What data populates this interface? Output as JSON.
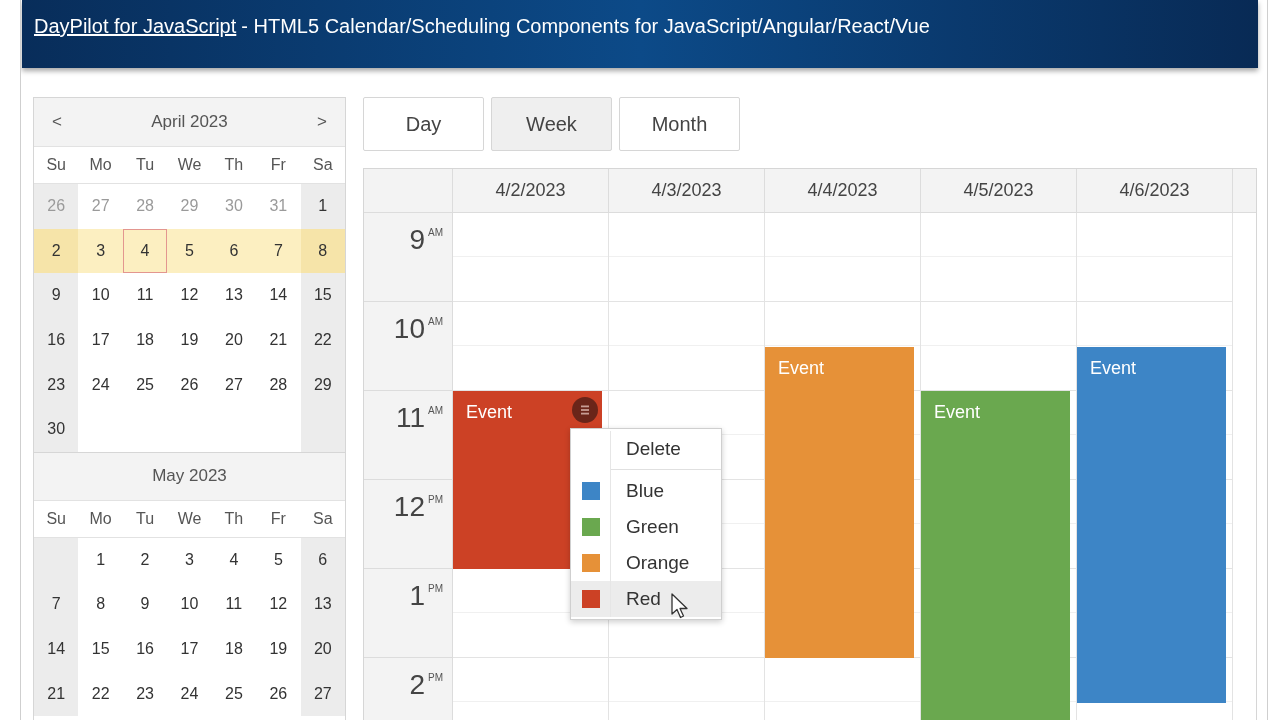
{
  "banner": {
    "link": "DayPilot for JavaScript",
    "tagline": "- HTML5 Calendar/Scheduling Components for JavaScript/Angular/React/Vue"
  },
  "navigator": {
    "months": [
      {
        "prev": "<",
        "title": "April 2023",
        "next": ">",
        "weekdays": [
          "Su",
          "Mo",
          "Tu",
          "We",
          "Th",
          "Fr",
          "Sa"
        ],
        "weeks": [
          {
            "selected": false,
            "days": [
              {
                "text": "26",
                "other_month": true,
                "today": false
              },
              {
                "text": "27",
                "other_month": true,
                "today": false
              },
              {
                "text": "28",
                "other_month": true,
                "today": false
              },
              {
                "text": "29",
                "other_month": true,
                "today": false
              },
              {
                "text": "30",
                "other_month": true,
                "today": false
              },
              {
                "text": "31",
                "other_month": true,
                "today": false
              },
              {
                "text": "1",
                "other_month": false,
                "today": false
              }
            ]
          },
          {
            "selected": true,
            "days": [
              {
                "text": "2",
                "other_month": false,
                "today": false
              },
              {
                "text": "3",
                "other_month": false,
                "today": false
              },
              {
                "text": "4",
                "other_month": false,
                "today": true
              },
              {
                "text": "5",
                "other_month": false,
                "today": false
              },
              {
                "text": "6",
                "other_month": false,
                "today": false
              },
              {
                "text": "7",
                "other_month": false,
                "today": false
              },
              {
                "text": "8",
                "other_month": false,
                "today": false
              }
            ]
          },
          {
            "selected": false,
            "days": [
              {
                "text": "9",
                "other_month": false,
                "today": false
              },
              {
                "text": "10",
                "other_month": false,
                "today": false
              },
              {
                "text": "11",
                "other_month": false,
                "today": false
              },
              {
                "text": "12",
                "other_month": false,
                "today": false
              },
              {
                "text": "13",
                "other_month": false,
                "today": false
              },
              {
                "text": "14",
                "other_month": false,
                "today": false
              },
              {
                "text": "15",
                "other_month": false,
                "today": false
              }
            ]
          },
          {
            "selected": false,
            "days": [
              {
                "text": "16",
                "other_month": false,
                "today": false
              },
              {
                "text": "17",
                "other_month": false,
                "today": false
              },
              {
                "text": "18",
                "other_month": false,
                "today": false
              },
              {
                "text": "19",
                "other_month": false,
                "today": false
              },
              {
                "text": "20",
                "other_month": false,
                "today": false
              },
              {
                "text": "21",
                "other_month": false,
                "today": false
              },
              {
                "text": "22",
                "other_month": false,
                "today": false
              }
            ]
          },
          {
            "selected": false,
            "days": [
              {
                "text": "23",
                "other_month": false,
                "today": false
              },
              {
                "text": "24",
                "other_month": false,
                "today": false
              },
              {
                "text": "25",
                "other_month": false,
                "today": false
              },
              {
                "text": "26",
                "other_month": false,
                "today": false
              },
              {
                "text": "27",
                "other_month": false,
                "today": false
              },
              {
                "text": "28",
                "other_month": false,
                "today": false
              },
              {
                "text": "29",
                "other_month": false,
                "today": false
              }
            ]
          },
          {
            "selected": false,
            "days": [
              {
                "text": "30",
                "other_month": false,
                "today": false
              }
            ]
          }
        ]
      },
      {
        "title": "May 2023",
        "weekdays": [
          "Su",
          "Mo",
          "Tu",
          "We",
          "Th",
          "Fr",
          "Sa"
        ],
        "weeks": [
          {
            "selected": false,
            "days": [
              {
                "text": "1",
                "other_month": false,
                "today": false
              },
              {
                "text": "2",
                "other_month": false,
                "today": false
              },
              {
                "text": "3",
                "other_month": false,
                "today": false
              },
              {
                "text": "4",
                "other_month": false,
                "today": false
              },
              {
                "text": "5",
                "other_month": false,
                "today": false
              },
              {
                "text": "6",
                "other_month": false,
                "today": false
              }
            ]
          },
          {
            "selected": false,
            "days": [
              {
                "text": "7",
                "other_month": false,
                "today": false
              },
              {
                "text": "8",
                "other_month": false,
                "today": false
              },
              {
                "text": "9",
                "other_month": false,
                "today": false
              },
              {
                "text": "10",
                "other_month": false,
                "today": false
              },
              {
                "text": "11",
                "other_month": false,
                "today": false
              },
              {
                "text": "12",
                "other_month": false,
                "today": false
              },
              {
                "text": "13",
                "other_month": false,
                "today": false
              }
            ]
          },
          {
            "selected": false,
            "days": [
              {
                "text": "14",
                "other_month": false,
                "today": false
              },
              {
                "text": "15",
                "other_month": false,
                "today": false
              },
              {
                "text": "16",
                "other_month": false,
                "today": false
              },
              {
                "text": "17",
                "other_month": false,
                "today": false
              },
              {
                "text": "18",
                "other_month": false,
                "today": false
              },
              {
                "text": "19",
                "other_month": false,
                "today": false
              },
              {
                "text": "20",
                "other_month": false,
                "today": false
              }
            ]
          },
          {
            "selected": false,
            "days": [
              {
                "text": "21",
                "other_month": false,
                "today": false
              },
              {
                "text": "22",
                "other_month": false,
                "today": false
              },
              {
                "text": "23",
                "other_month": false,
                "today": false
              },
              {
                "text": "24",
                "other_month": false,
                "today": false
              },
              {
                "text": "25",
                "other_month": false,
                "today": false
              },
              {
                "text": "26",
                "other_month": false,
                "today": false
              },
              {
                "text": "27",
                "other_month": false,
                "today": false
              }
            ]
          }
        ]
      }
    ]
  },
  "view_buttons": [
    {
      "label": "Day",
      "selected": false
    },
    {
      "label": "Week",
      "selected": true
    },
    {
      "label": "Month",
      "selected": false
    }
  ],
  "calendar": {
    "hours": [
      {
        "hour": "9",
        "ampm": "AM"
      },
      {
        "hour": "10",
        "ampm": "AM"
      },
      {
        "hour": "11",
        "ampm": "AM"
      },
      {
        "hour": "12",
        "ampm": "PM"
      },
      {
        "hour": "1",
        "ampm": "PM"
      },
      {
        "hour": "2",
        "ampm": "PM"
      }
    ],
    "columns": [
      {
        "date": "4/2/2023",
        "events": [
          {
            "text": "Event",
            "color": "#cc4125",
            "active": true
          }
        ]
      },
      {
        "date": "4/3/2023"
      },
      {
        "date": "4/4/2023",
        "events": [
          {
            "text": "Event",
            "color": "#e69138",
            "active": false
          }
        ]
      },
      {
        "date": "4/5/2023",
        "events": [
          {
            "text": "Event",
            "color": "#6aa84f",
            "active": false
          }
        ]
      },
      {
        "date": "4/6/2023",
        "events": [
          {
            "text": "Event",
            "color": "#3d85c6",
            "active": false
          }
        ]
      }
    ]
  },
  "context_menu": {
    "items": [
      {
        "kind": "action",
        "text": "Delete",
        "highlighted": false
      },
      {
        "kind": "separator"
      },
      {
        "kind": "color",
        "text": "Blue",
        "color": "#3d85c6",
        "highlighted": false
      },
      {
        "kind": "color",
        "text": "Green",
        "color": "#6aa84f",
        "highlighted": false
      },
      {
        "kind": "color",
        "text": "Orange",
        "color": "#e69138",
        "highlighted": false
      },
      {
        "kind": "color",
        "text": "Red",
        "color": "#cc4125",
        "highlighted": true
      }
    ]
  }
}
